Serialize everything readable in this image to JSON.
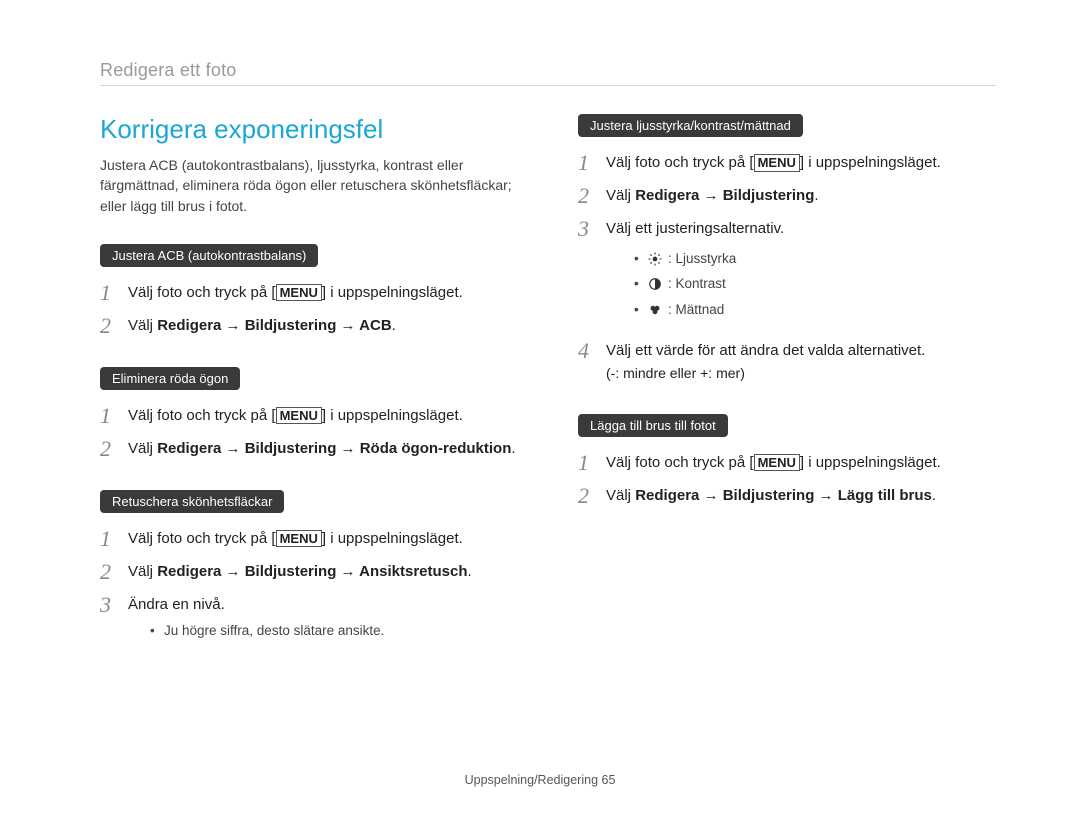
{
  "header": {
    "breadcrumb": "Redigera ett foto"
  },
  "section": {
    "title": "Korrigera exponeringsfel",
    "intro": "Justera ACB (autokontrastbalans), ljusstyrka, kontrast eller färgmättnad, eliminera röda ögon eller retuschera skönhetsfläckar; eller lägg till brus i fotot."
  },
  "left": {
    "acb": {
      "pill": "Justera ACB (autokontrastbalans)",
      "step1_prefix": "Välj foto och tryck på [",
      "menu": "MENU",
      "step1_suffix": "] i uppspelningsläget.",
      "step2_prefix": "Välj ",
      "step2_strong": "Redigera → Bildjustering → ACB",
      "step2_suffix": "."
    },
    "redeye": {
      "pill": "Eliminera röda ögon",
      "step1_prefix": "Välj foto och tryck på [",
      "menu": "MENU",
      "step1_suffix": "] i uppspelningsläget.",
      "step2_prefix": "Välj ",
      "step2_strong": "Redigera → Bildjustering → Röda ögon-reduktion",
      "step2_suffix": "."
    },
    "retouch": {
      "pill": "Retuschera skönhetsfläckar",
      "step1_prefix": "Välj foto och tryck på [",
      "menu": "MENU",
      "step1_suffix": "] i uppspelningsläget.",
      "step2_prefix": "Välj ",
      "step2_strong": "Redigera → Bildjustering → Ansiktsretusch",
      "step2_suffix": ".",
      "step3": "Ändra en nivå.",
      "bullet1": "Ju högre siffra, desto slätare ansikte."
    }
  },
  "right": {
    "adjust": {
      "pill": "Justera ljusstyrka/kontrast/mättnad",
      "step1_prefix": "Välj foto och tryck på [",
      "menu": "MENU",
      "step1_suffix": "] i uppspelningsläget.",
      "step2_prefix": "Välj ",
      "step2_strong": "Redigera → Bildjustering",
      "step2_suffix": ".",
      "step3": "Välj ett justeringsalternativ.",
      "opt1": ": Ljusstyrka",
      "opt2": ": Kontrast",
      "opt3": ": Mättnad",
      "step4": "Välj ett värde för att ändra det valda alternativet.",
      "step4_sub": "(-: mindre eller +: mer)"
    },
    "noise": {
      "pill": "Lägga till brus till fotot",
      "step1_prefix": "Välj foto och tryck på [",
      "menu": "MENU",
      "step1_suffix": "] i uppspelningsläget.",
      "step2_prefix": "Välj ",
      "step2_strong": "Redigera → Bildjustering → Lägg till brus",
      "step2_suffix": "."
    }
  },
  "footer": {
    "section": "Uppspelning/Redigering ",
    "page": "65"
  },
  "numbers": {
    "n1": "1",
    "n2": "2",
    "n3": "3",
    "n4": "4"
  }
}
